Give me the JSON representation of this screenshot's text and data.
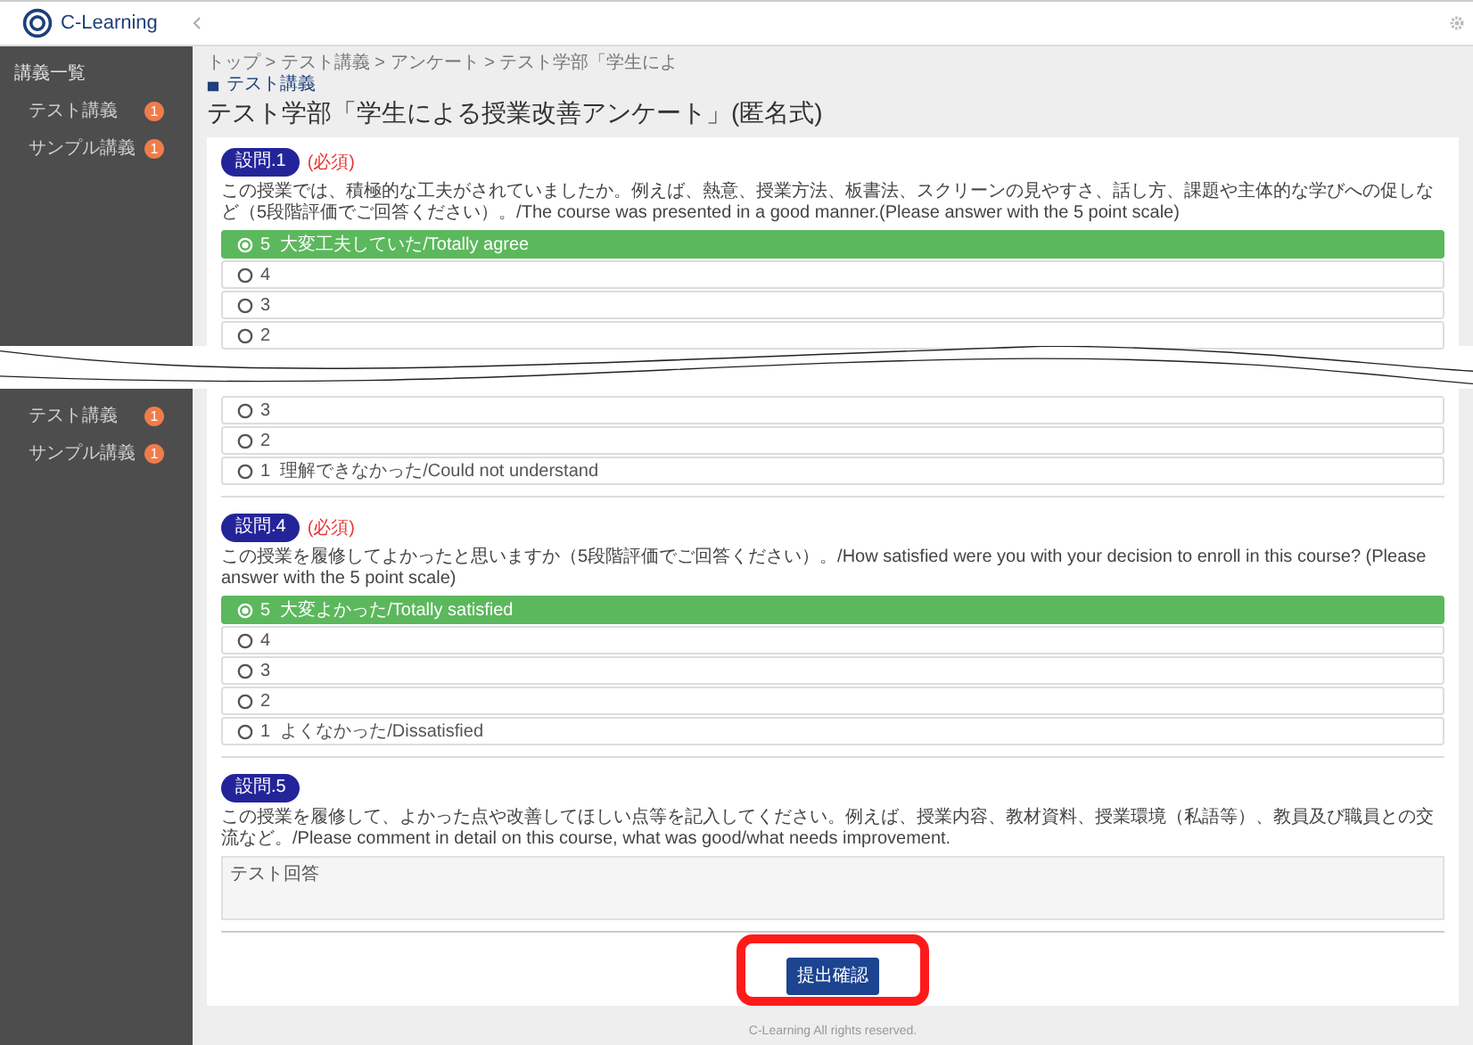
{
  "top_view": {
    "logo": "C-Learning",
    "sidebar": {
      "heading": "講義一覧",
      "items": [
        {
          "label": "テスト講義",
          "badge": "1"
        },
        {
          "label": "サンプル講義",
          "badge": "1"
        }
      ]
    },
    "breadcrumb": "トップ > テスト講義 > アンケート > テスト学部「学生によ",
    "course": "テスト講義",
    "title": "テスト学部「学生による授業改善アンケート」(匿名式)",
    "question": {
      "number": "設問.1",
      "required": "(必須)",
      "text": "この授業では、積極的な工夫がされていましたか。例えば、熱意、授業方法、板書法、スクリーンの見やすさ、話し方、課題や主体的な学びへの促しなど（5段階評価でご回答ください）。/The course was presented in a good manner.(Please answer with the 5 point scale)",
      "options": [
        {
          "label": "5  大変工夫していた/Totally agree",
          "selected": true
        },
        {
          "label": "4",
          "selected": false
        },
        {
          "label": "3",
          "selected": false
        },
        {
          "label": "2",
          "selected": false
        }
      ]
    }
  },
  "bottom_view": {
    "sidebar": {
      "items": [
        {
          "label": "テスト講義",
          "badge": "1"
        },
        {
          "label": "サンプル講義",
          "badge": "1"
        }
      ]
    },
    "partial_options": [
      {
        "label": "3",
        "selected": false
      },
      {
        "label": "2",
        "selected": false
      },
      {
        "label": "1  理解できなかった/Could not understand",
        "selected": false
      }
    ],
    "questions": [
      {
        "kind": "choice",
        "number": "設問.4",
        "required": "(必須)",
        "text": "この授業を履修してよかったと思いますか（5段階評価でご回答ください）。/How satisfied were you with your decision to enroll in this course? (Please answer with the 5 point scale)",
        "options": [
          {
            "label": "5  大変よかった/Totally satisfied",
            "selected": true
          },
          {
            "label": "4",
            "selected": false
          },
          {
            "label": "3",
            "selected": false
          },
          {
            "label": "2",
            "selected": false
          },
          {
            "label": "1  よくなかった/Dissatisfied",
            "selected": false
          }
        ]
      },
      {
        "kind": "comment",
        "number": "設問.5",
        "text": "この授業を履修して、よかった点や改善してほしい点等を記入してください。例えば、授業内容、教材資料、授業環境（私語等）、教員及び職員との交流など。/Please comment in detail on this course, what was good/what needs improvement.",
        "value": "テスト回答"
      }
    ],
    "submit_button": "提出確認",
    "footer": "C-Learning All rights reserved."
  }
}
